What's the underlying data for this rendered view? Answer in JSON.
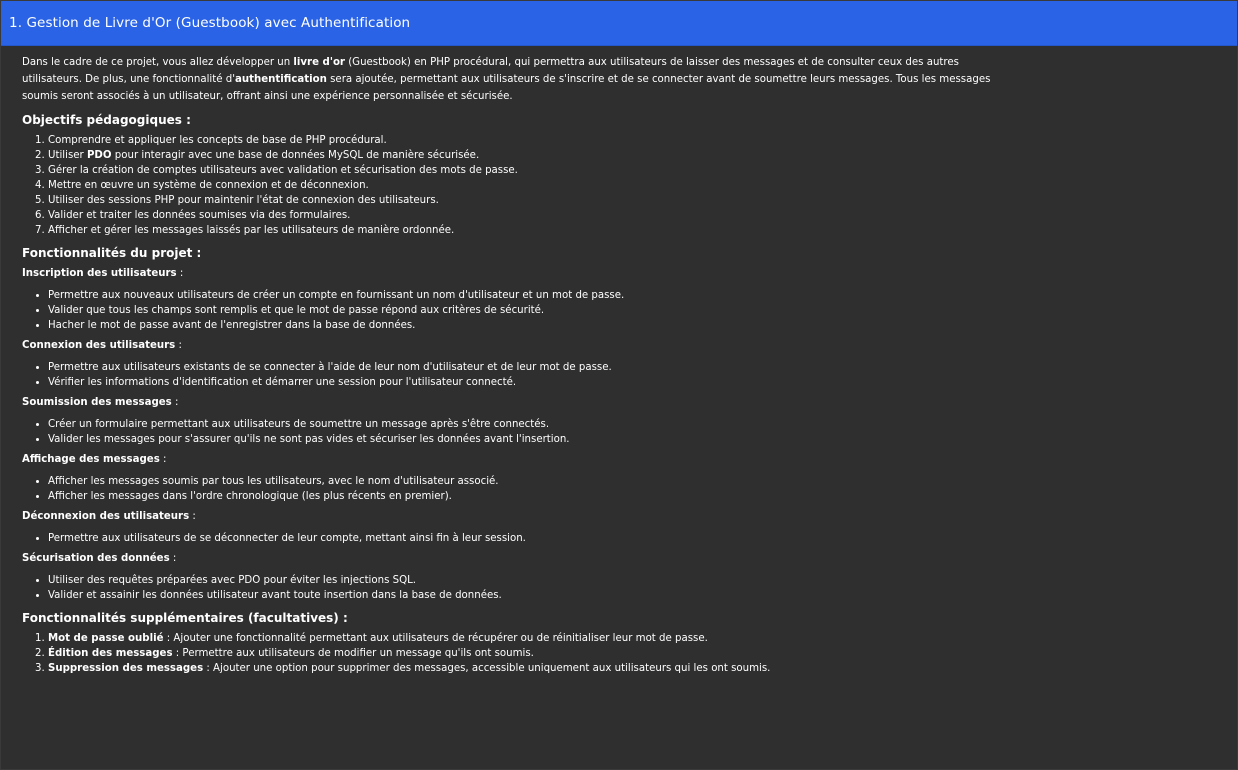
{
  "header": {
    "title": "1. Gestion de Livre d'Or (Guestbook) avec Authentification"
  },
  "intro": {
    "p1": "Dans le cadre de ce projet, vous allez développer un ",
    "b1": "livre d'or",
    "p2": " (Guestbook) en PHP procédural, qui permettra aux utilisateurs de laisser des messages et de consulter ceux des autres utilisateurs. De plus, une fonctionnalité d'",
    "b2": "authentification",
    "p3": " sera ajoutée, permettant aux utilisateurs de s'inscrire et de se connecter avant de soumettre leurs messages. Tous les messages soumis seront associés à un utilisateur, offrant ainsi une expérience personnalisée et sécurisée."
  },
  "objectives": {
    "heading": "Objectifs pédagogiques :",
    "items": [
      {
        "text": "Comprendre et appliquer les concepts de base de PHP procédural."
      },
      {
        "pre": "Utiliser ",
        "bold": "PDO",
        "post": " pour interagir avec une base de données MySQL de manière sécurisée."
      },
      {
        "text": "Gérer la création de comptes utilisateurs avec validation et sécurisation des mots de passe."
      },
      {
        "text": "Mettre en œuvre un système de connexion et de déconnexion."
      },
      {
        "text": "Utiliser des sessions PHP pour maintenir l'état de connexion des utilisateurs."
      },
      {
        "text": "Valider et traiter les données soumises via des formulaires."
      },
      {
        "text": "Afficher et gérer les messages laissés par les utilisateurs de manière ordonnée."
      }
    ]
  },
  "features": {
    "heading": "Fonctionnalités du projet :",
    "sections": [
      {
        "title": "Inscription des utilisateurs",
        "colon": " :",
        "items": [
          "Permettre aux nouveaux utilisateurs de créer un compte en fournissant un nom d'utilisateur et un mot de passe.",
          "Valider que tous les champs sont remplis et que le mot de passe répond aux critères de sécurité.",
          "Hacher le mot de passe avant de l'enregistrer dans la base de données."
        ]
      },
      {
        "title": "Connexion des utilisateurs",
        "colon": " :",
        "items": [
          "Permettre aux utilisateurs existants de se connecter à l'aide de leur nom d'utilisateur et de leur mot de passe.",
          "Vérifier les informations d'identification et démarrer une session pour l'utilisateur connecté."
        ]
      },
      {
        "title": "Soumission des messages",
        "colon": " :",
        "items": [
          "Créer un formulaire permettant aux utilisateurs de soumettre un message après s'être connectés.",
          "Valider les messages pour s'assurer qu'ils ne sont pas vides et sécuriser les données avant l'insertion."
        ]
      },
      {
        "title": "Affichage des messages",
        "colon": " :",
        "items": [
          "Afficher les messages soumis par tous les utilisateurs, avec le nom d'utilisateur associé.",
          "Afficher les messages dans l'ordre chronologique (les plus récents en premier)."
        ]
      },
      {
        "title": "Déconnexion des utilisateurs",
        "colon": " :",
        "items": [
          "Permettre aux utilisateurs de se déconnecter de leur compte, mettant ainsi fin à leur session."
        ]
      },
      {
        "title": "Sécurisation des données",
        "colon": " :",
        "items": [
          "Utiliser des requêtes préparées avec PDO pour éviter les injections SQL.",
          "Valider et assainir les données utilisateur avant toute insertion dans la base de données."
        ]
      }
    ]
  },
  "extras": {
    "heading": "Fonctionnalités supplémentaires (facultatives) :",
    "items": [
      {
        "bold": "Mot de passe oublié",
        "post": " : Ajouter une fonctionnalité permettant aux utilisateurs de récupérer ou de réinitialiser leur mot de passe."
      },
      {
        "bold": "Édition des messages",
        "post": " : Permettre aux utilisateurs de modifier un message qu'ils ont soumis."
      },
      {
        "bold": "Suppression des messages",
        "post": " : Ajouter une option pour supprimer des messages, accessible uniquement aux utilisateurs qui les ont soumis."
      }
    ]
  }
}
